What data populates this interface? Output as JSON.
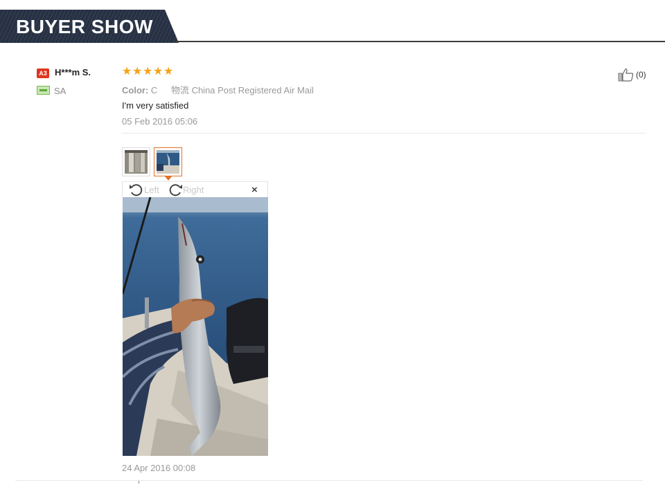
{
  "header": {
    "title": "BUYER SHOW"
  },
  "reviewer": {
    "level": "A3",
    "name": "H***m S.",
    "country": "SA"
  },
  "review": {
    "rating": 5,
    "stars": [
      "★",
      "★",
      "★",
      "★",
      "★"
    ],
    "color_label": "Color:",
    "color_value": "C",
    "shipping_label": "物流",
    "shipping_value": "China Post Registered Air Mail",
    "feedback": "I'm very satisfied",
    "date": "05 Feb 2016 05:06",
    "helpful_count": "(0)"
  },
  "viewer": {
    "rotate_left": "Left",
    "rotate_right": "Right",
    "close": "×",
    "photo_date": "24 Apr 2016 00:08"
  },
  "colors": {
    "star": "#f7a219",
    "selected_thumb": "#e37226",
    "banner": "#283346",
    "level_badge": "#e0351e"
  }
}
